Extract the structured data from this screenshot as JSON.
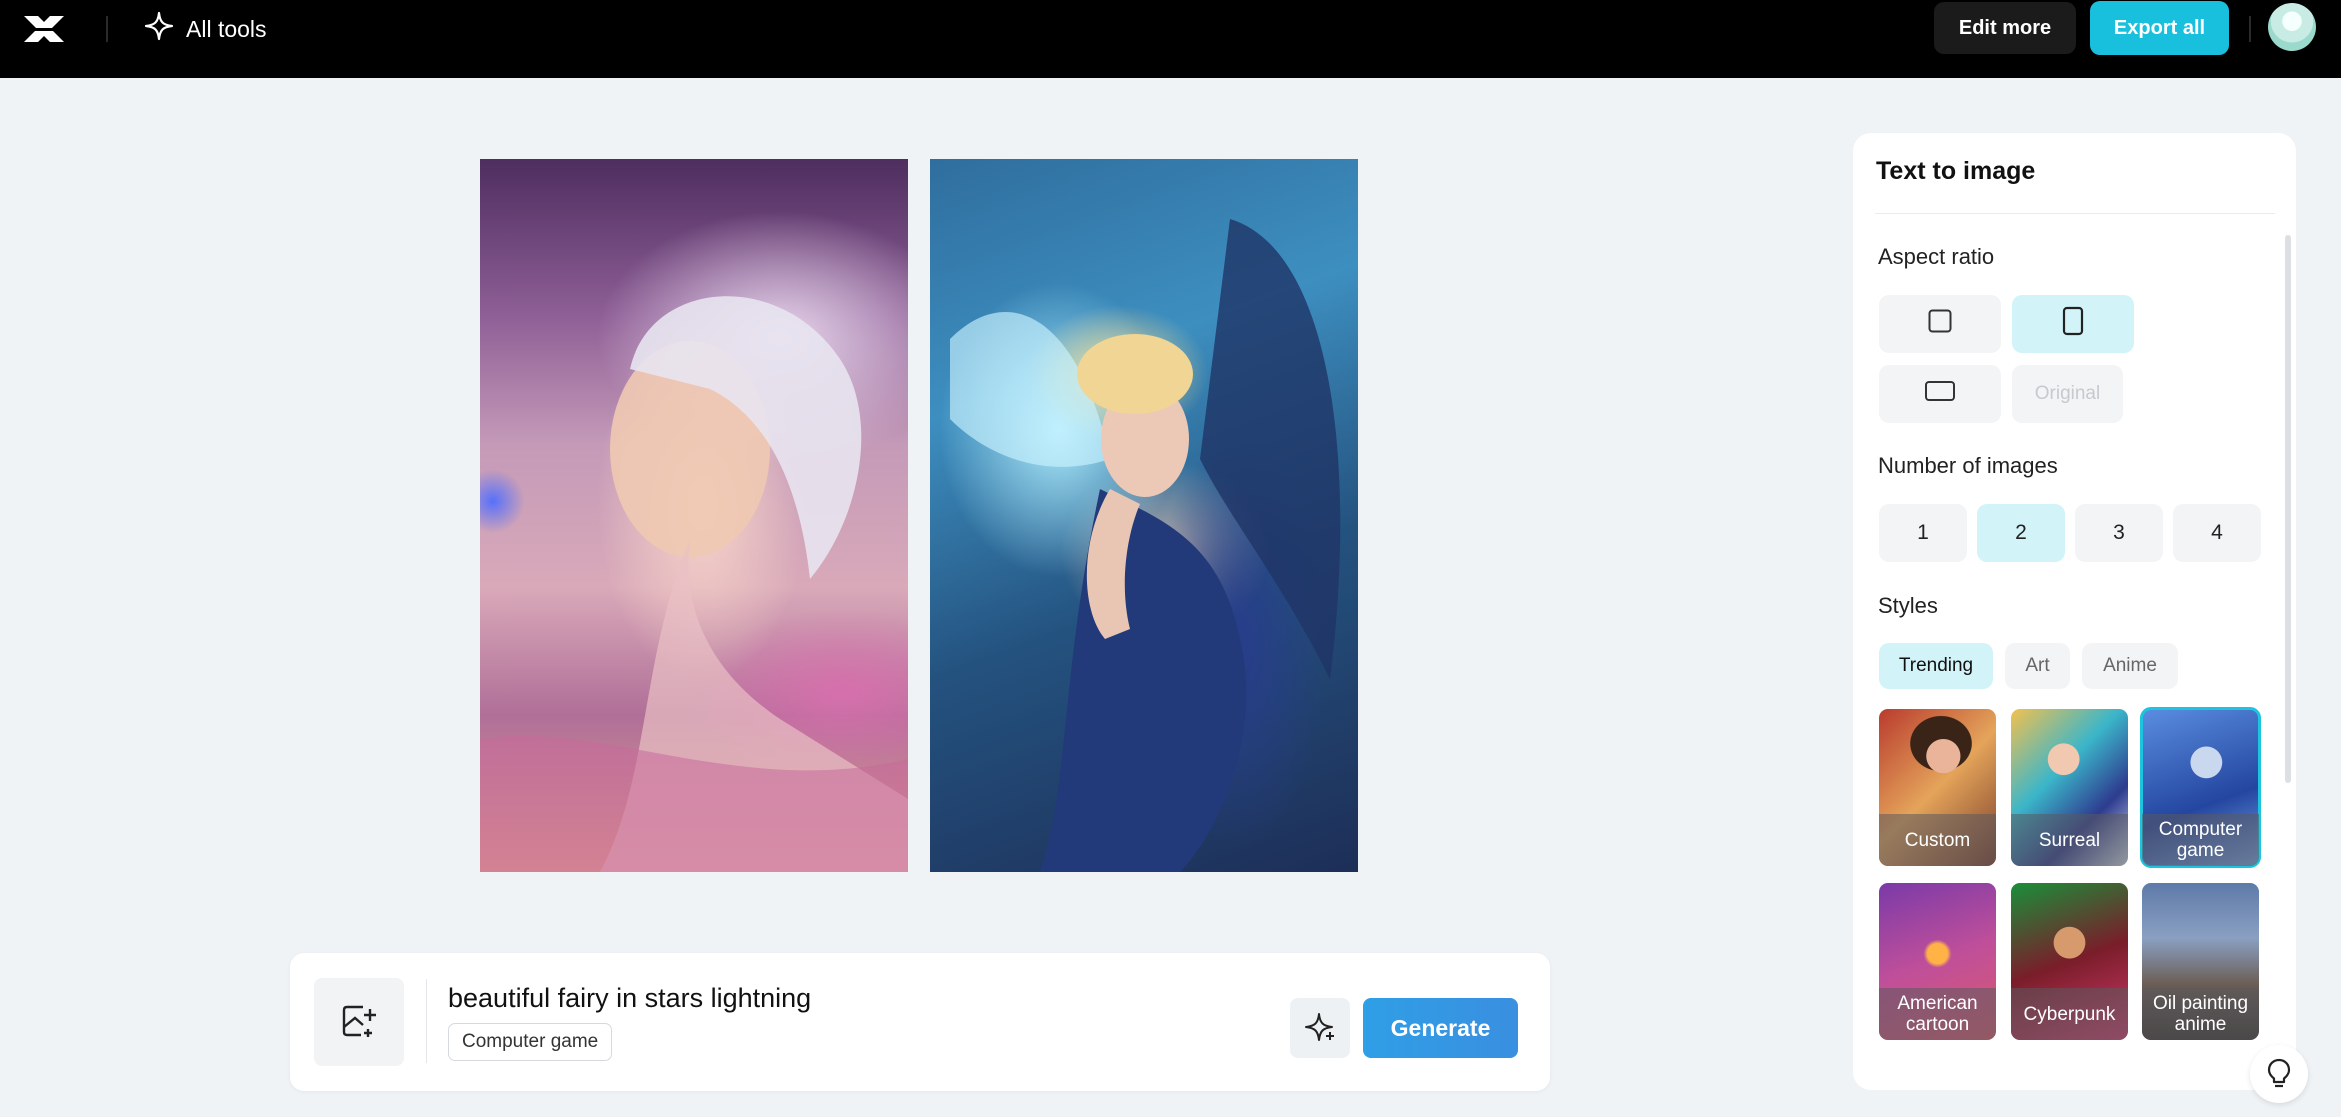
{
  "header": {
    "logo": "capcut-logo",
    "all_tools_label": "All tools",
    "edit_more_label": "Edit more",
    "export_all_label": "Export all"
  },
  "canvas": {
    "images": [
      {
        "name": "generated-image-1",
        "description": "white-haired fairy on pink-purple background"
      },
      {
        "name": "generated-image-2",
        "description": "blonde fairy with blue wings"
      }
    ]
  },
  "prompt": {
    "text": "beautiful fairy in stars lightning",
    "style_tag": "Computer game",
    "generate_label": "Generate"
  },
  "panel": {
    "title": "Text to image",
    "aspect_ratio": {
      "label": "Aspect ratio",
      "options": [
        {
          "icon": "square-icon",
          "selected": false
        },
        {
          "icon": "portrait-icon",
          "selected": true
        },
        {
          "icon": "landscape-icon",
          "selected": false
        },
        {
          "label": "Original",
          "selected": false,
          "disabled": true
        }
      ]
    },
    "number_of_images": {
      "label": "Number of images",
      "options": [
        "1",
        "2",
        "3",
        "4"
      ],
      "selected": "2"
    },
    "styles": {
      "label": "Styles",
      "tabs": [
        "Trending",
        "Art",
        "Anime"
      ],
      "selected_tab": "Trending",
      "items": [
        {
          "label": "Custom",
          "selected": false
        },
        {
          "label": "Surreal",
          "selected": false
        },
        {
          "label": "Computer game",
          "selected": true
        },
        {
          "label": "American cartoon",
          "selected": false
        },
        {
          "label": "Cyberpunk",
          "selected": false
        },
        {
          "label": "Oil painting anime",
          "selected": false
        }
      ]
    }
  },
  "colors": {
    "accent": "#19c0dd",
    "generate": "#3a9be4",
    "selected_bg": "#d2f3f8",
    "topbar": "#000000",
    "page_bg": "#eff3f6"
  }
}
